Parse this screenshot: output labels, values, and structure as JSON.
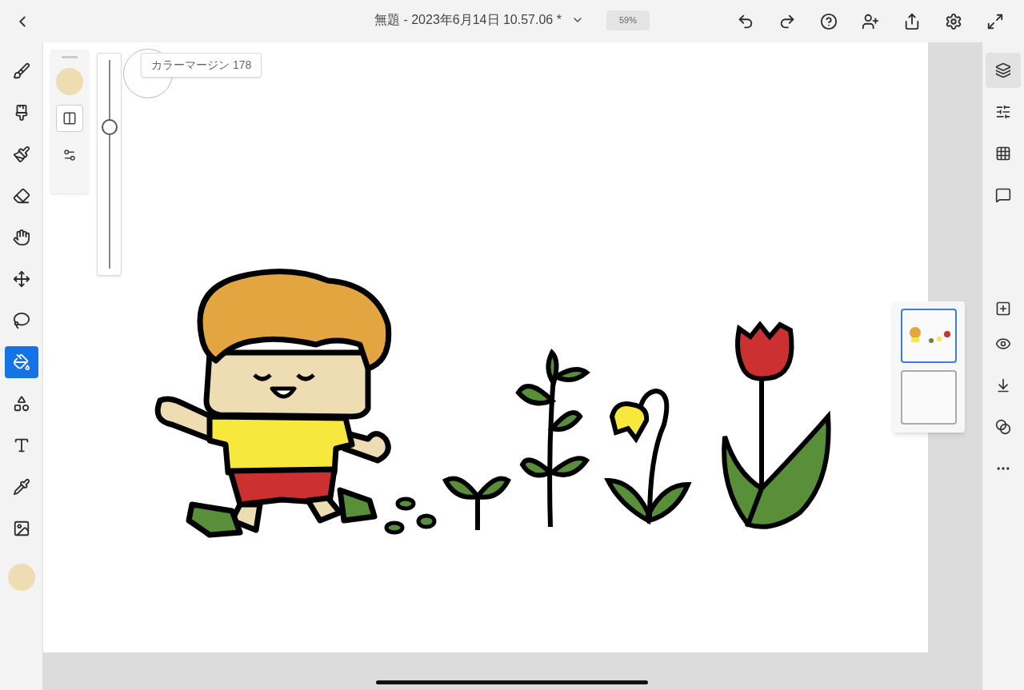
{
  "document": {
    "title": "無題 - 2023年6月14日 10.57.06 *",
    "zoom": "59%"
  },
  "tools": [
    {
      "kind": "pixel-brush",
      "selected": false
    },
    {
      "kind": "live-brush",
      "selected": false
    },
    {
      "kind": "vector-brush",
      "selected": false
    },
    {
      "kind": "eraser",
      "selected": false
    },
    {
      "kind": "smudge",
      "selected": false
    },
    {
      "kind": "move",
      "selected": false
    },
    {
      "kind": "lasso",
      "selected": false
    },
    {
      "kind": "fill",
      "selected": true
    },
    {
      "kind": "shapes",
      "selected": false
    },
    {
      "kind": "text",
      "selected": false
    },
    {
      "kind": "eyedropper",
      "selected": false
    },
    {
      "kind": "image",
      "selected": false
    }
  ],
  "color_swatch": {
    "color": "#eedcb2"
  },
  "fill_options": {
    "modes": [
      {
        "kind": "contiguous",
        "selected": true
      },
      {
        "kind": "settings",
        "selected": false
      }
    ],
    "tooltip": "カラーマージン 178",
    "level": 0.68
  },
  "panel_tools": [
    {
      "kind": "layers",
      "selected": true
    },
    {
      "kind": "properties",
      "selected": false
    },
    {
      "kind": "grid",
      "selected": false
    },
    {
      "kind": "comments",
      "selected": false
    },
    {
      "kind": "add-layer",
      "selected": false
    },
    {
      "kind": "visibility",
      "selected": false
    },
    {
      "kind": "merge",
      "selected": false
    },
    {
      "kind": "blend",
      "selected": false
    },
    {
      "kind": "more",
      "selected": false
    }
  ],
  "layers": [
    {
      "kind": "pixel",
      "selected": true
    },
    {
      "kind": "image",
      "selected": false
    }
  ]
}
